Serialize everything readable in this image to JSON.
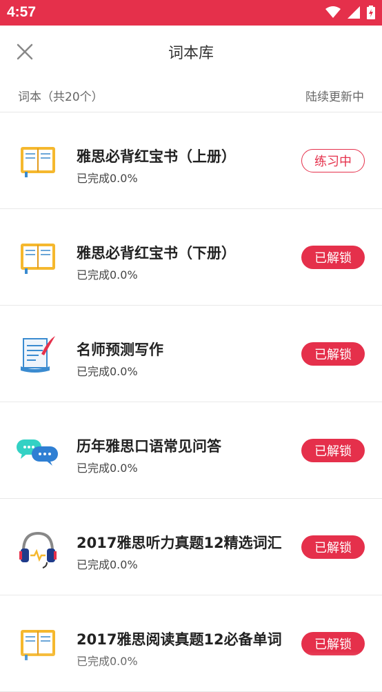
{
  "status_bar": {
    "time": "4:57"
  },
  "header": {
    "title": "词本库"
  },
  "subheader": {
    "count_label": "词本（共20个）",
    "more_label": "陆续更新中"
  },
  "accent_color": "#e5304b",
  "books": [
    {
      "name": "雅思必背红宝书（上册）",
      "progress": "已完成0.0%",
      "action": "练习中",
      "style": "outline",
      "icon": "book-icon"
    },
    {
      "name": "雅思必背红宝书（下册）",
      "progress": "已完成0.0%",
      "action": "已解锁",
      "style": "solid",
      "icon": "book-icon"
    },
    {
      "name": "名师预测写作",
      "progress": "已完成0.0%",
      "action": "已解锁",
      "style": "solid",
      "icon": "writing-icon"
    },
    {
      "name": "历年雅思口语常见问答",
      "progress": "已完成0.0%",
      "action": "已解锁",
      "style": "solid",
      "icon": "chat-bubbles-icon"
    },
    {
      "name": "2017雅思听力真题12精选词汇",
      "progress": "已完成0.0%",
      "action": "已解锁",
      "style": "solid",
      "icon": "headphones-icon"
    },
    {
      "name": "2017雅思阅读真题12必备单词",
      "progress": "已完成0.0%",
      "action": "已解锁",
      "style": "solid",
      "icon": "book-icon"
    }
  ]
}
